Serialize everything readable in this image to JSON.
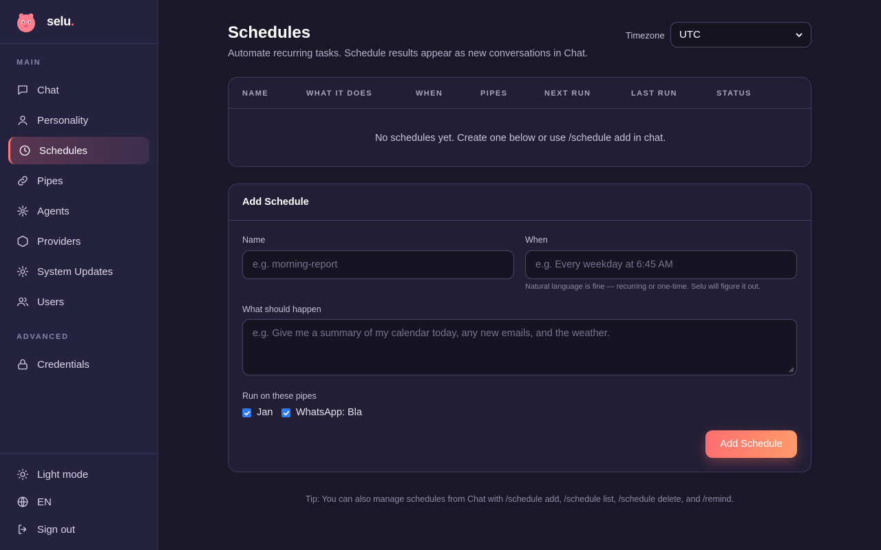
{
  "brand": {
    "name": "selu",
    "dot": "."
  },
  "sidebar": {
    "section_main": "MAIN",
    "section_advanced": "ADVANCED",
    "items": [
      {
        "label": "Chat",
        "icon": "chat-icon"
      },
      {
        "label": "Personality",
        "icon": "user-icon"
      },
      {
        "label": "Schedules",
        "icon": "clock-icon",
        "active": true
      },
      {
        "label": "Pipes",
        "icon": "link-icon"
      },
      {
        "label": "Agents",
        "icon": "agents-icon"
      },
      {
        "label": "Providers",
        "icon": "hexagon-icon"
      },
      {
        "label": "System Updates",
        "icon": "gear-icon"
      },
      {
        "label": "Users",
        "icon": "users-icon"
      }
    ],
    "advanced_items": [
      {
        "label": "Credentials",
        "icon": "lock-icon"
      }
    ],
    "bottom": [
      {
        "label": "Light mode",
        "icon": "sun-icon"
      },
      {
        "label": "EN",
        "icon": "globe-icon"
      },
      {
        "label": "Sign out",
        "icon": "sign-out-icon"
      }
    ]
  },
  "header": {
    "title": "Schedules",
    "subtitle": "Automate recurring tasks. Schedule results appear as new conversations in Chat.",
    "timezone_label": "Timezone",
    "timezone_value": "UTC"
  },
  "table": {
    "columns": [
      "NAME",
      "WHAT IT DOES",
      "WHEN",
      "PIPES",
      "NEXT RUN",
      "LAST RUN",
      "STATUS"
    ],
    "rows": [],
    "empty_message": "No schedules yet. Create one below or use /schedule add in chat."
  },
  "form": {
    "title": "Add Schedule",
    "name_label": "Name",
    "name_placeholder": "e.g. morning-report",
    "when_label": "When",
    "when_placeholder": "e.g. Every weekday at 6:45 AM",
    "when_hint": "Natural language is fine — recurring or one-time. Selu will figure it out.",
    "what_label": "What should happen",
    "what_placeholder": "e.g. Give me a summary of my calendar today, any new emails, and the weather.",
    "pipes_label": "Run on these pipes",
    "pipes": [
      {
        "label": "Jan",
        "checked": true
      },
      {
        "label": "WhatsApp: Bla",
        "checked": true
      }
    ],
    "submit_label": "Add Schedule"
  },
  "tip": "Tip: You can also manage schedules from Chat with /schedule add, /schedule list, /schedule delete, and /remind.",
  "colors": {
    "accent": "#ff7a7a",
    "background": "#1a1729",
    "sidebar": "#252240",
    "checkbox": "#2f7bf6"
  }
}
